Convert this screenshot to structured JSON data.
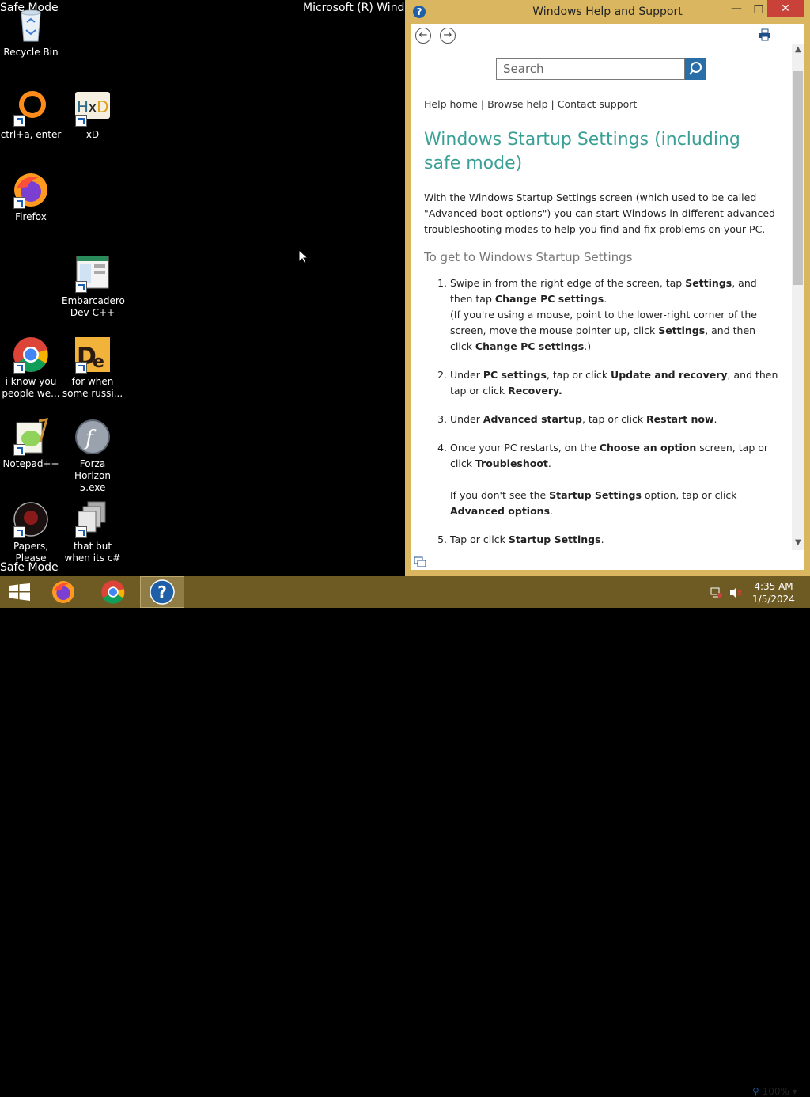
{
  "desktop": {
    "safe_mode_top": "Safe Mode",
    "safe_mode_bottom": "Safe Mode",
    "window_title_fragment": "Microsoft (R) Windo",
    "icons": [
      {
        "label": "Recycle Bin",
        "icon": "recycle-bin-icon"
      },
      {
        "label": "ctrl+a, enter",
        "icon": "ring-icon"
      },
      {
        "label": "xD",
        "icon": "hxd-icon"
      },
      {
        "label": "Firefox",
        "icon": "firefox-icon"
      },
      {
        "label": "Embarcadero Dev-C++",
        "icon": "devcpp-icon"
      },
      {
        "label": "i know you people we...",
        "icon": "chrome-icon"
      },
      {
        "label": "for when some russi...",
        "icon": "de-icon"
      },
      {
        "label": "Notepad++",
        "icon": "notepadpp-icon"
      },
      {
        "label": "Forza Horizon 5.exe",
        "icon": "flash-icon"
      },
      {
        "label": "Papers, Please",
        "icon": "papers-please-icon"
      },
      {
        "label": "that but when its c#",
        "icon": "stack-icon"
      }
    ]
  },
  "help": {
    "title": "Windows Help and Support",
    "search_placeholder": "Search",
    "nav_links": "Help home | Browse help | Contact support",
    "heading": "Windows Startup Settings (including safe mode)",
    "intro": "With the Windows Startup Settings screen (which used to be called \"Advanced boot options\") you can start Windows in different advanced troubleshooting modes to help you find and fix problems on your PC.",
    "subheading": "To get to Windows Startup Settings",
    "steps": [
      {
        "html": "Swipe in from the right edge of the screen, tap <b>Settings</b>, and then tap <b>Change PC settings</b>.<br>(If you're using a mouse, point to the lower-right corner of the screen, move the mouse pointer up, click <b>Settings</b>, and then click <b>Change PC settings</b>.)"
      },
      {
        "html": "Under <b>PC settings</b>, tap or click <b>Update and recovery</b>, and then tap or click <b>Recovery.</b>"
      },
      {
        "html": "Under <b>Advanced startup</b>, tap or click <b>Restart now</b>."
      },
      {
        "html": "Once your PC restarts, on the <b>Choose an option</b> screen, tap or click <b>Troubleshoot</b>.<br><br>If you don't see the <b>Startup Settings</b> option, tap or click <b>Advanced options</b>."
      },
      {
        "html": "Tap or click <b>Startup Settings</b>."
      }
    ],
    "zoom": "100%"
  },
  "taskbar": {
    "time": "4:35 AM",
    "date": "1/5/2024"
  },
  "colors": {
    "window_frame": "#d9b65f",
    "taskbar": "#6e5b24",
    "heading": "#3aa095",
    "close_button": "#c8423a"
  }
}
